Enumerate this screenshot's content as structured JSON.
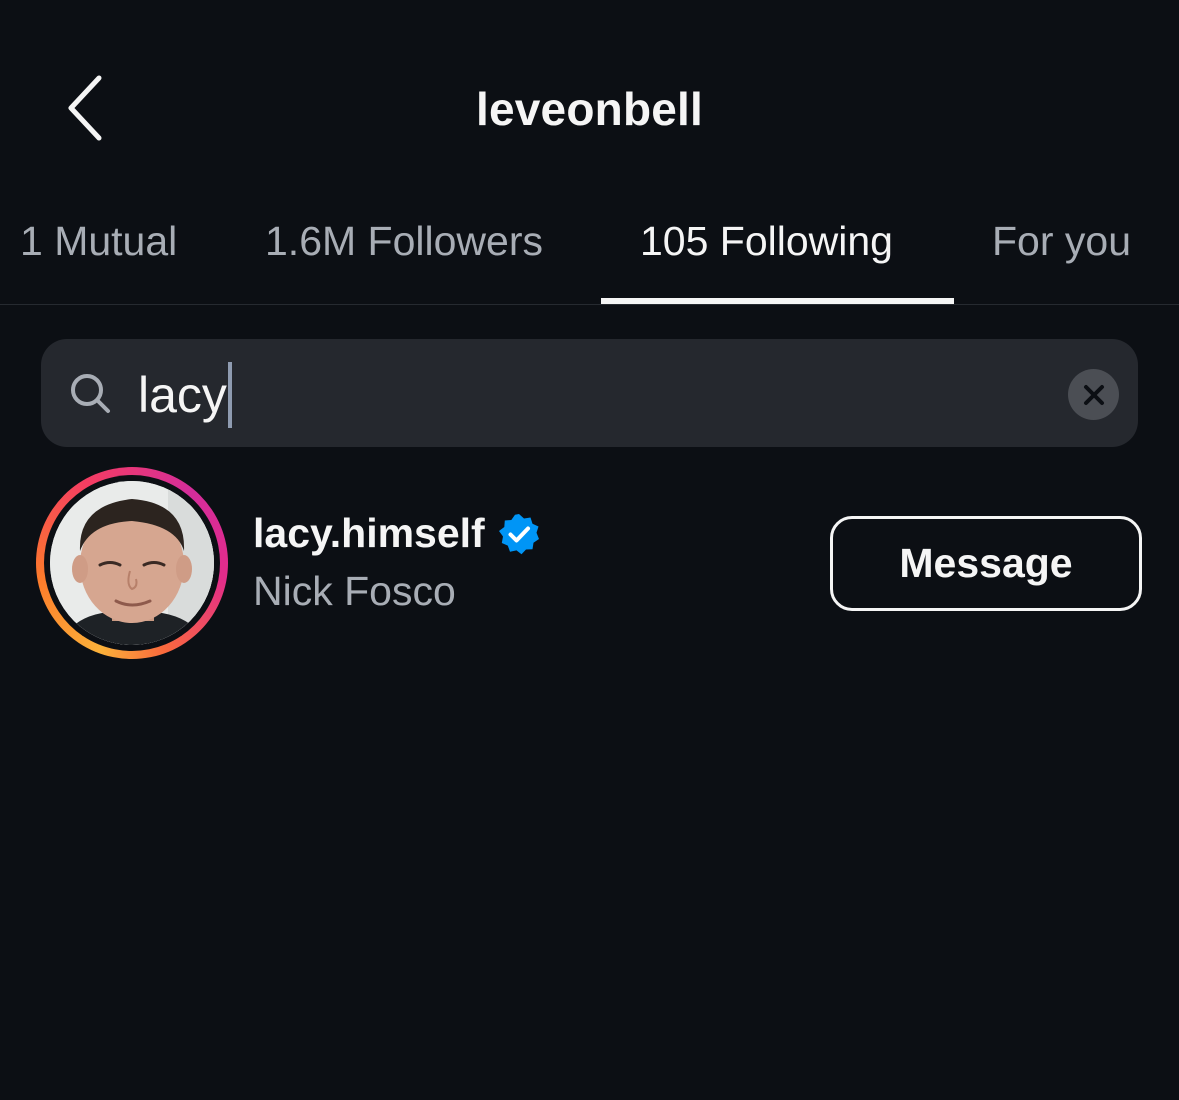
{
  "header": {
    "title": "leveonbell",
    "back_icon": "chevron-left-icon"
  },
  "tabs": [
    {
      "label": "1 Mutual",
      "active": false
    },
    {
      "label": "1.6M Followers",
      "active": false
    },
    {
      "label": "105 Following",
      "active": true
    },
    {
      "label": "For you",
      "active": false
    }
  ],
  "search": {
    "value": "lacy",
    "icon": "search-icon",
    "clear_icon": "close-icon"
  },
  "results": [
    {
      "username": "lacy.himself",
      "full_name": "Nick Fosco",
      "verified": true,
      "has_story": true,
      "action_label": "Message"
    }
  ],
  "colors": {
    "background": "#0c0f14",
    "search_bg": "#25282e",
    "text_primary": "#f5f5f5",
    "text_secondary": "#a8adb5",
    "verified_blue": "#0095f6"
  }
}
